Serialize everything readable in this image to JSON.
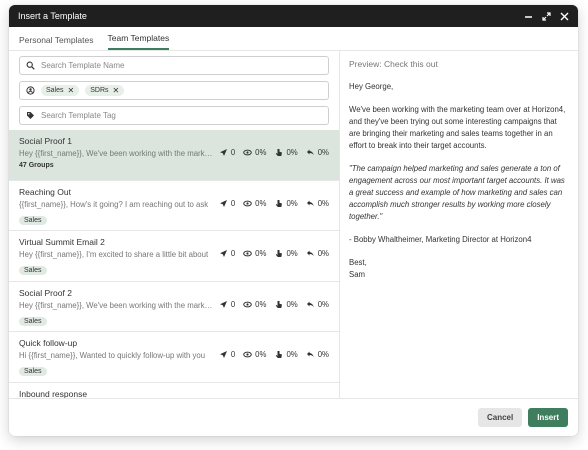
{
  "window": {
    "title": "Insert a Template"
  },
  "tabs": [
    {
      "label": "Personal Templates",
      "active": false
    },
    {
      "label": "Team Templates",
      "active": true
    }
  ],
  "filters": {
    "search_placeholder": "Search Template Name",
    "groups": [
      "Sales",
      "SDRs"
    ],
    "tag_placeholder": "Search Template Tag"
  },
  "templates": [
    {
      "name": "Social Proof 1",
      "preview": "Hey {{first_name}}, We've been working with the marketing team over at",
      "extra": "47 Groups",
      "sent": "0",
      "opened": "0%",
      "clicked": "0%",
      "replied": "0%"
    },
    {
      "name": "Reaching Out",
      "preview": "{{first_name}}, How's it going? I am reaching out to ask",
      "extra": "Sales",
      "sent": "0",
      "opened": "0%",
      "clicked": "0%",
      "replied": "0%"
    },
    {
      "name": "Virtual Summit Email 2",
      "preview": "Hey {{first_name}}, I'm excited to share a little bit about",
      "extra": "Sales",
      "sent": "0",
      "opened": "0%",
      "clicked": "0%",
      "replied": "0%"
    },
    {
      "name": "Social Proof 2",
      "preview": "Hey {{first_name}}, We've been working with the marketing team",
      "extra": "Sales",
      "sent": "0",
      "opened": "0%",
      "clicked": "0%",
      "replied": "0%"
    },
    {
      "name": "Quick follow-up",
      "preview": "Hi {{first_name}}, Wanted to quickly follow-up with you",
      "extra": "Sales",
      "sent": "0",
      "opened": "0%",
      "clicked": "0%",
      "replied": "0%"
    },
    {
      "name": "Inbound response",
      "preview": "",
      "extra": ""
    }
  ],
  "preview": {
    "title": "Preview: Check this out",
    "greeting": "Hey George,",
    "body": "We've been working with the marketing team over at Horizon4, and they've been trying out some interesting campaigns that are bringing their marketing and sales teams together in an effort to break into their target accounts.",
    "quote": "\"The campaign helped marketing and sales generate a ton of engagement across our most important target accounts. It was a great success and example of how marketing and sales can accomplish much stronger results by working more closely together.\"",
    "attribution": "- Bobby Whaltheimer, Marketing Director at Horizon4",
    "signoff": "Best,",
    "signature": "Sam"
  },
  "footer": {
    "cancel": "Cancel",
    "insert": "Insert"
  },
  "colors": {
    "accent": "#3e7d5e",
    "selected_row": "#dbe5de",
    "titlebar": "#1f1f1f"
  }
}
